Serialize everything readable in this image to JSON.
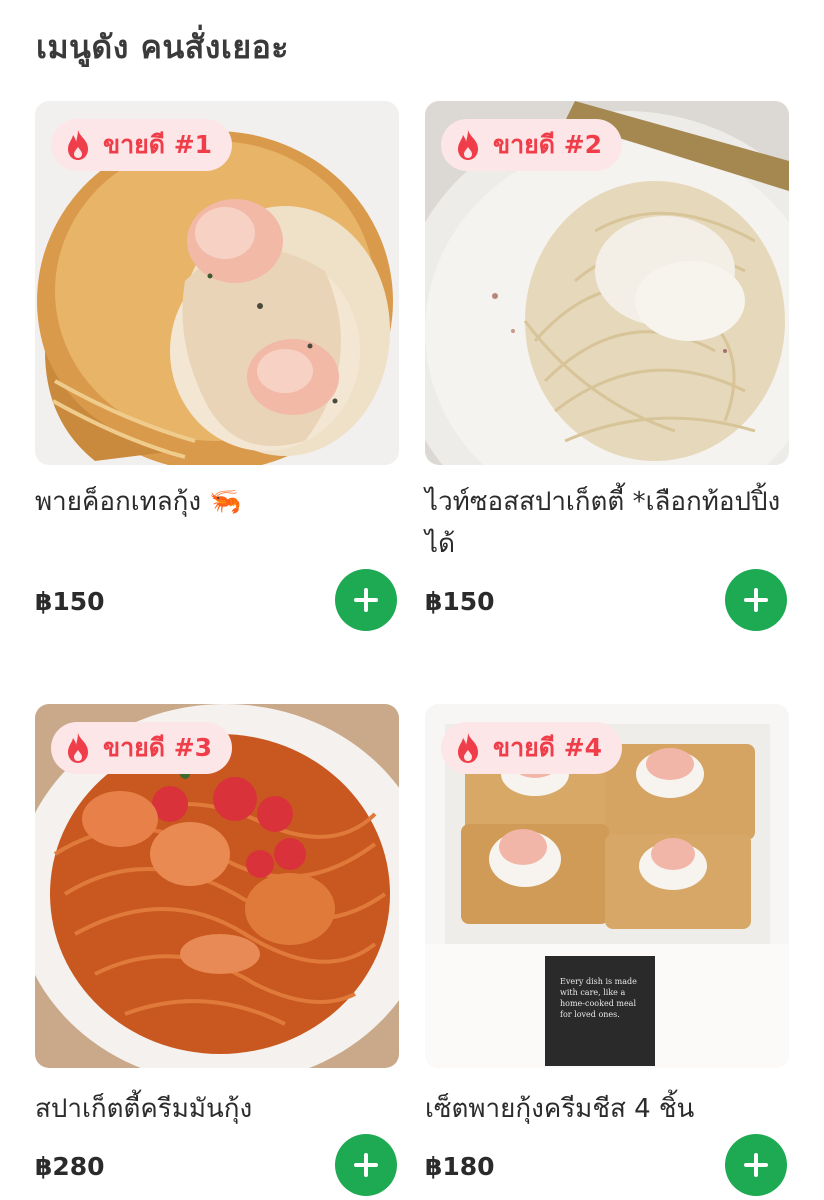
{
  "section": {
    "title": "เมนูดัง คนสั่งเยอะ"
  },
  "products": [
    {
      "badge": "ขายดี #1",
      "name": "พายค็อกเทลกุ้ง 🦐",
      "price": "฿150"
    },
    {
      "badge": "ขายดี #2",
      "name": "ไวท์ซอสสปาเก็ตตี้ *เลือกท้อปปิ้งได้",
      "price": "฿150"
    },
    {
      "badge": "ขายดี #3",
      "name": "สปาเก็ตตี้ครีมมันกุ้ง",
      "price": "฿280"
    },
    {
      "badge": "ขายดี #4",
      "name": "เซ็ตพายกุ้งครีมชีส 4 ชิ้น",
      "price": "฿180"
    }
  ],
  "box_text": "Every dish is made with care, like a home-cooked meal for loved ones.",
  "icons": {
    "badge": "fire-icon",
    "add": "plus-icon"
  },
  "colors": {
    "badge_bg": "#fde6e7",
    "badge_text": "#ef3e4a",
    "add_button": "#1eaa52",
    "text": "#2b2b2b"
  }
}
